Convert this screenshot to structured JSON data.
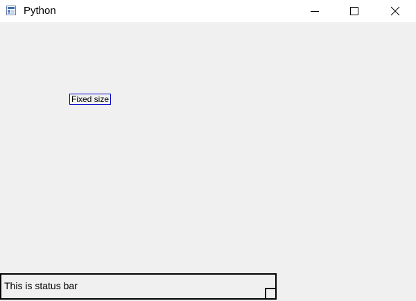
{
  "window": {
    "title": "Python",
    "icon": "python-app-icon"
  },
  "controls": {
    "minimize_icon": "minimize-icon",
    "maximize_icon": "maximize-icon",
    "close_icon": "close-icon"
  },
  "content": {
    "fixed_button_label": "Fixed size"
  },
  "statusbar": {
    "text": "This is status bar"
  },
  "colors": {
    "background": "#f0f0f0",
    "titlebar": "#ffffff",
    "button_border": "#0000cc",
    "statusbar_border": "#000000"
  }
}
